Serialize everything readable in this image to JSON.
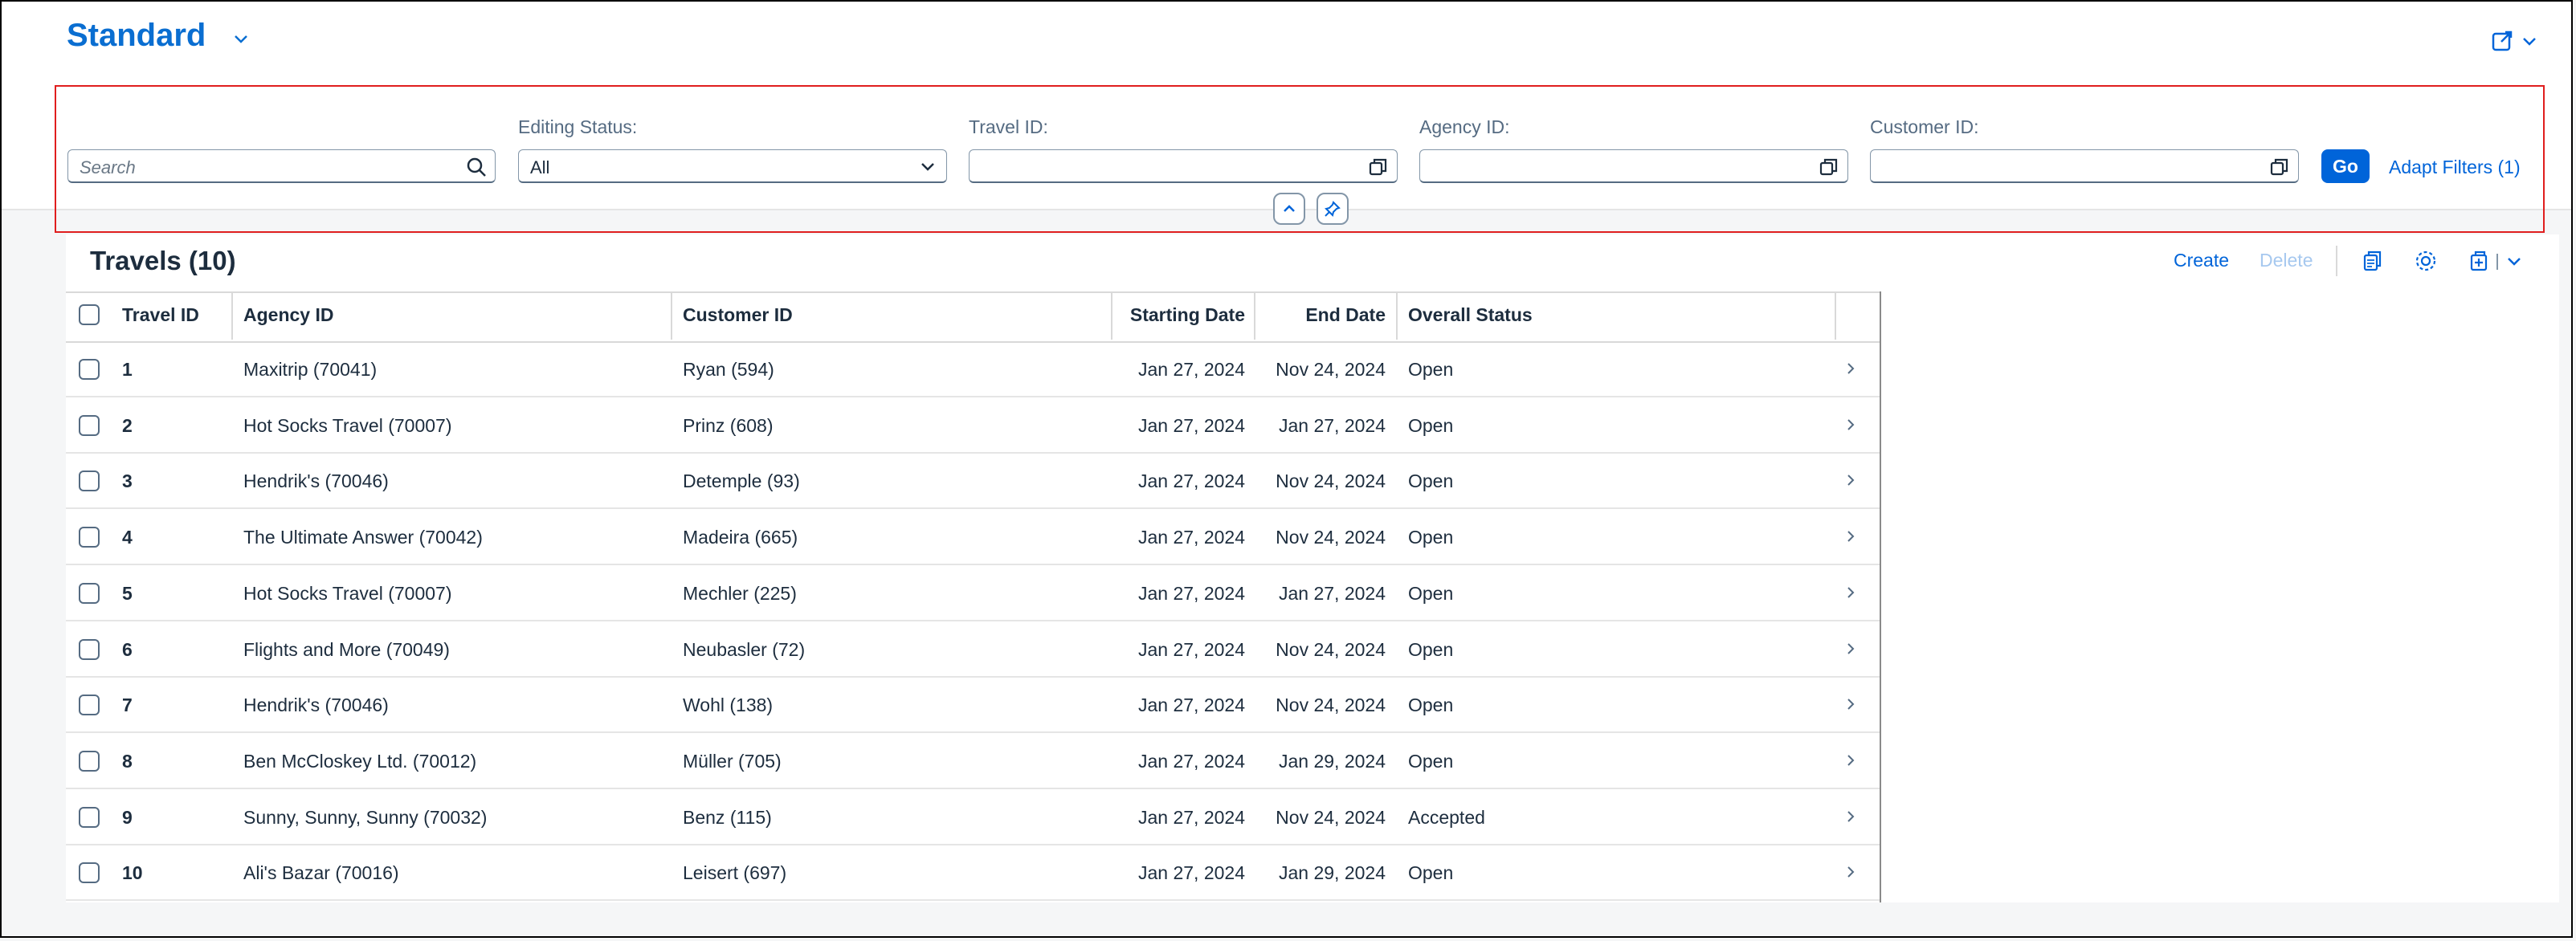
{
  "header": {
    "title": "Standard"
  },
  "filters": {
    "search_placeholder": "Search",
    "editing_status": {
      "label": "Editing Status:",
      "value": "All"
    },
    "travel_id": {
      "label": "Travel ID:",
      "value": ""
    },
    "agency_id": {
      "label": "Agency ID:",
      "value": ""
    },
    "customer_id": {
      "label": "Customer ID:",
      "value": ""
    },
    "go_label": "Go",
    "adapt_label": "Adapt Filters (1)"
  },
  "table": {
    "title": "Travels (10)",
    "create_label": "Create",
    "delete_label": "Delete",
    "columns": [
      "Travel ID",
      "Agency ID",
      "Customer ID",
      "Starting Date",
      "End Date",
      "Overall Status"
    ],
    "rows": [
      {
        "id": "1",
        "agency": "Maxitrip (70041)",
        "customer": "Ryan (594)",
        "start": "Jan 27, 2024",
        "end": "Nov 24, 2024",
        "status": "Open"
      },
      {
        "id": "2",
        "agency": "Hot Socks Travel (70007)",
        "customer": "Prinz (608)",
        "start": "Jan 27, 2024",
        "end": "Jan 27, 2024",
        "status": "Open"
      },
      {
        "id": "3",
        "agency": "Hendrik's (70046)",
        "customer": "Detemple (93)",
        "start": "Jan 27, 2024",
        "end": "Nov 24, 2024",
        "status": "Open"
      },
      {
        "id": "4",
        "agency": "The Ultimate Answer (70042)",
        "customer": "Madeira (665)",
        "start": "Jan 27, 2024",
        "end": "Nov 24, 2024",
        "status": "Open"
      },
      {
        "id": "5",
        "agency": "Hot Socks Travel (70007)",
        "customer": "Mechler (225)",
        "start": "Jan 27, 2024",
        "end": "Jan 27, 2024",
        "status": "Open"
      },
      {
        "id": "6",
        "agency": "Flights and More (70049)",
        "customer": "Neubasler (72)",
        "start": "Jan 27, 2024",
        "end": "Nov 24, 2024",
        "status": "Open"
      },
      {
        "id": "7",
        "agency": "Hendrik's (70046)",
        "customer": "Wohl (138)",
        "start": "Jan 27, 2024",
        "end": "Nov 24, 2024",
        "status": "Open"
      },
      {
        "id": "8",
        "agency": "Ben McCloskey Ltd. (70012)",
        "customer": "Müller (705)",
        "start": "Jan 27, 2024",
        "end": "Jan 29, 2024",
        "status": "Open"
      },
      {
        "id": "9",
        "agency": "Sunny, Sunny, Sunny (70032)",
        "customer": "Benz (115)",
        "start": "Jan 27, 2024",
        "end": "Nov 24, 2024",
        "status": "Accepted"
      },
      {
        "id": "10",
        "agency": "Ali's Bazar (70016)",
        "customer": "Leisert (697)",
        "start": "Jan 27, 2024",
        "end": "Jan 29, 2024",
        "status": "Open"
      }
    ]
  },
  "colors": {
    "accent": "#0064d9",
    "highlight_border": "#e01e1e"
  }
}
